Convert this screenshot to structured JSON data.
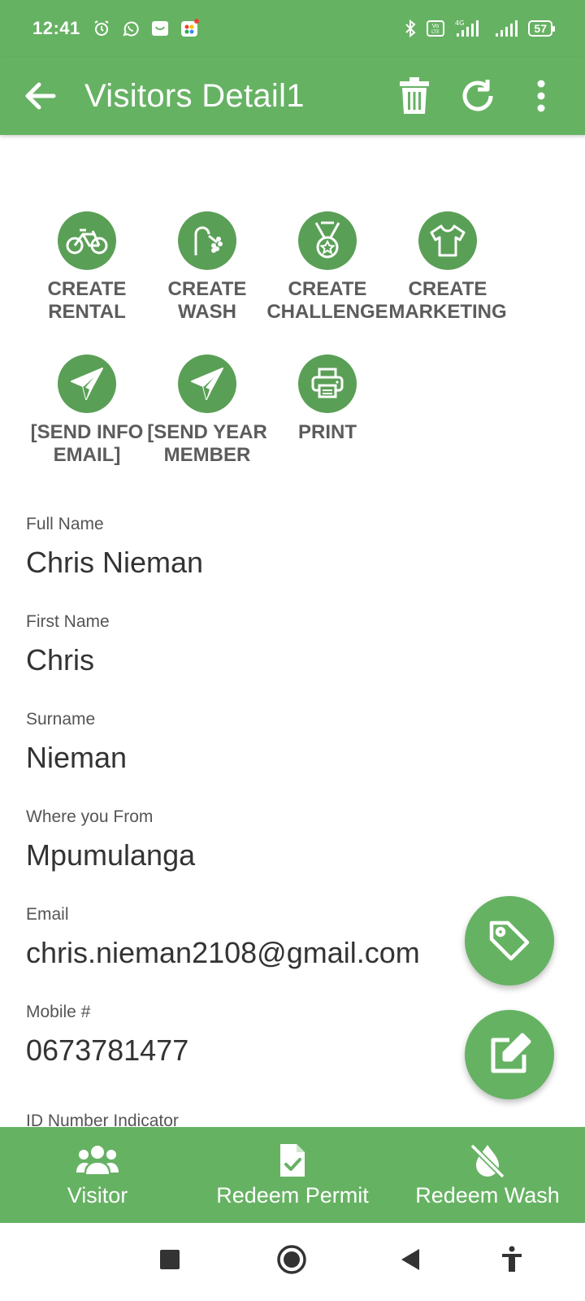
{
  "status_bar": {
    "time": "12:41",
    "battery": "57",
    "network": "4G"
  },
  "app_bar": {
    "title": "Visitors Detail1"
  },
  "quick_actions": [
    {
      "label": "CREATE RENTAL",
      "icon": "bicycle-icon"
    },
    {
      "label": "CREATE WASH",
      "icon": "shower-icon"
    },
    {
      "label": "CREATE CHALLENGE",
      "icon": "medal-icon"
    },
    {
      "label": "CREATE MARKETING ITEM",
      "icon": "tshirt-icon"
    },
    {
      "label": "[SEND INFO EMAIL]",
      "icon": "paper-plane-icon"
    },
    {
      "label": "[SEND YEAR MEMBER",
      "icon": "paper-plane-icon"
    },
    {
      "label": "PRINT",
      "icon": "printer-icon"
    }
  ],
  "fields": [
    {
      "label": "Full Name",
      "value": "Chris Nieman"
    },
    {
      "label": "First Name",
      "value": "Chris"
    },
    {
      "label": "Surname",
      "value": "Nieman"
    },
    {
      "label": "Where you From",
      "value": "Mpumulanga"
    },
    {
      "label": "Email",
      "value": "chris.nieman2108@gmail.com"
    },
    {
      "label": "Mobile #",
      "value": "0673781477"
    }
  ],
  "partial_field_label": "ID Number Indicator",
  "bottom_nav": [
    {
      "label": "Visitor",
      "icon": "users-icon"
    },
    {
      "label": "Redeem Permit",
      "icon": "file-check-icon"
    },
    {
      "label": "Redeem Wash",
      "icon": "no-water-icon"
    }
  ],
  "colors": {
    "primary": "#66b263",
    "action_circle": "#5a9f56",
    "label_gray": "#5c5c5c"
  }
}
